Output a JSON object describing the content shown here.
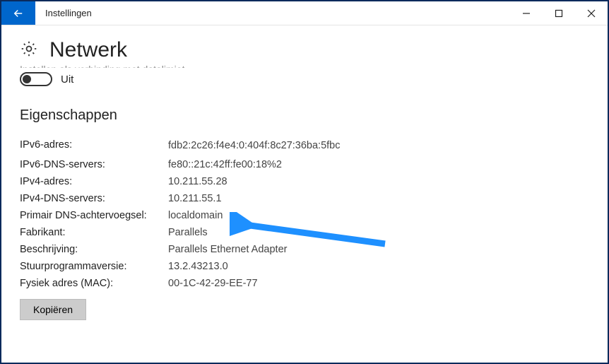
{
  "window": {
    "title": "Instellingen"
  },
  "page": {
    "title": "Netwerk",
    "clipped_text": "Instellen als verbinding met datalimiet"
  },
  "toggle": {
    "state_label": "Uit"
  },
  "section": {
    "title": "Eigenschappen"
  },
  "properties": {
    "ipv6_address_label": "IPv6-adres:",
    "ipv6_address_value": "fdb2:2c26:f4e4:0:404f:8c27:36ba:5fbc",
    "ipv6_dns_label": "IPv6-DNS-servers:",
    "ipv6_dns_value": "fe80::21c:42ff:fe00:18%2",
    "ipv4_address_label": "IPv4-adres:",
    "ipv4_address_value": "10.211.55.28",
    "ipv4_dns_label": "IPv4-DNS-servers:",
    "ipv4_dns_value": "10.211.55.1",
    "primary_dns_suffix_label": "Primair DNS-achtervoegsel:",
    "primary_dns_suffix_value": "localdomain",
    "manufacturer_label": "Fabrikant:",
    "manufacturer_value": "Parallels",
    "description_label": "Beschrijving:",
    "description_value": "Parallels Ethernet Adapter",
    "driver_version_label": "Stuurprogrammaversie:",
    "driver_version_value": "13.2.43213.0",
    "mac_label": "Fysiek adres (MAC):",
    "mac_value": "00-1C-42-29-EE-77"
  },
  "buttons": {
    "copy": "Kopiëren"
  },
  "annotation": {
    "color": "#1e90ff"
  }
}
